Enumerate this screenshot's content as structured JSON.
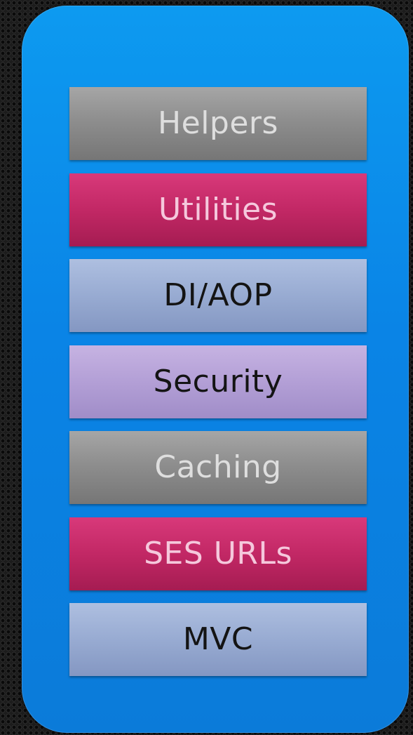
{
  "layers": [
    {
      "label": "Helpers",
      "color": "#8e8e8e"
    },
    {
      "label": "Utilities",
      "color": "#c22865"
    },
    {
      "label": "DI/AOP",
      "color": "#98abd2"
    },
    {
      "label": "Security",
      "color": "#b39fd6"
    },
    {
      "label": "Caching",
      "color": "#8e8e8e"
    },
    {
      "label": "SES URLs",
      "color": "#c22865"
    },
    {
      "label": "MVC",
      "color": "#98abd2"
    }
  ],
  "panel_color": "#0a84e6"
}
